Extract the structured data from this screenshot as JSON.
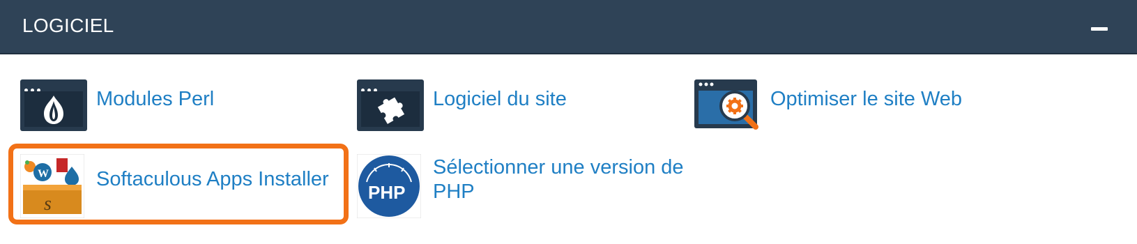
{
  "section": {
    "title": "LOGICIEL",
    "collapse_icon": "minus-icon"
  },
  "items": [
    {
      "label": "Modules Perl",
      "icon": "perl-onion-icon"
    },
    {
      "label": "Logiciel du site",
      "icon": "puzzle-icon"
    },
    {
      "label": "Optimiser le site Web",
      "icon": "optimize-magnifier-icon"
    },
    {
      "label": "Softaculous Apps Installer",
      "icon": "softaculous-icon"
    },
    {
      "label": "Sélectionner une version de PHP",
      "icon": "php-icon"
    }
  ],
  "colors": {
    "header_bg": "#2f4357",
    "link": "#1f7fc4",
    "highlight": "#f27117"
  }
}
